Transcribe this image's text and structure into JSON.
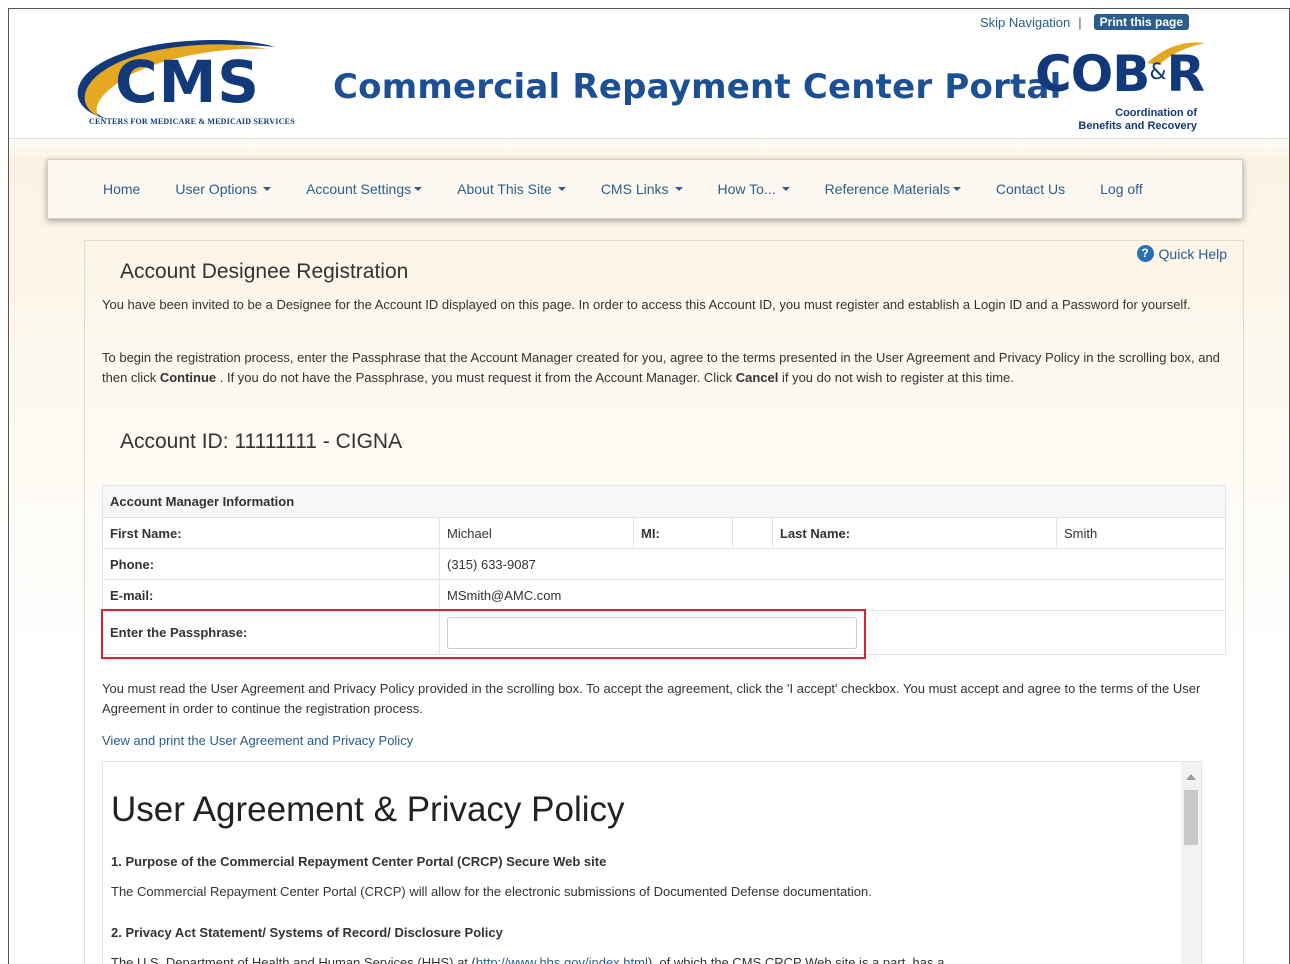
{
  "header": {
    "skip_nav": "Skip Navigation",
    "separator": "|",
    "print_label": "Print this page",
    "cms_logo_text": "CMS",
    "cms_logo_subtitle": "CENTERS FOR MEDICARE & MEDICAID SERVICES",
    "portal_title": "Commercial Repayment Center Portal",
    "cob_logo_main": "COB",
    "cob_logo_amp": "&",
    "cob_logo_r": "R",
    "cob_logo_line1": "Coordination of",
    "cob_logo_line2": "Benefits and Recovery"
  },
  "nav": {
    "items": [
      {
        "label": "Home",
        "dropdown": false
      },
      {
        "label": "User Options",
        "dropdown": true
      },
      {
        "label": "Account Settings",
        "dropdown": true
      },
      {
        "label": "About This Site",
        "dropdown": true
      },
      {
        "label": "CMS Links",
        "dropdown": true
      },
      {
        "label": "How To...",
        "dropdown": true
      },
      {
        "label": "Reference Materials",
        "dropdown": true
      },
      {
        "label": "Contact Us",
        "dropdown": false
      },
      {
        "label": "Log off",
        "dropdown": false
      }
    ]
  },
  "main": {
    "quick_help": "Quick Help",
    "help_icon_glyph": "?",
    "title": "Account Designee Registration",
    "intro1": "You have been invited to be a Designee for the Account ID displayed on this page. In order to access this Account ID, you must register and establish a Login ID and a Password for yourself.",
    "intro2_a": "To begin the registration process, enter the Passphrase that the Account Manager created for you, agree to the terms presented in the User Agreement and Privacy Policy in the scrolling box, and then click ",
    "intro2_continue": "Continue",
    "intro2_b": " . If you do not have the Passphrase, you must request it from the Account Manager. Click ",
    "intro2_cancel": "Cancel",
    "intro2_c": " if you do not wish to register at this time.",
    "account_id": "Account ID: 11111111 - CIGNA"
  },
  "manager_table": {
    "header": "Account Manager Information",
    "first_name_label": "First Name:",
    "first_name": "Michael",
    "mi_label": "MI:",
    "mi": "",
    "last_name_label": "Last Name:",
    "last_name": "Smith",
    "phone_label": "Phone:",
    "phone": "(315) 633-9087",
    "email_label": "E-mail:",
    "email": "MSmith@AMC.com",
    "passphrase_label": "Enter the Passphrase:",
    "passphrase_value": ""
  },
  "agreement": {
    "instructions": "You must read the User Agreement and Privacy Policy provided in the scrolling box. To accept the agreement, click the 'I accept' checkbox. You must accept and agree to the terms of the User Agreement in order to continue the registration process.",
    "view_print_link": "View and print the User Agreement and Privacy Policy",
    "title": "User Agreement & Privacy Policy",
    "s1_heading": "1. Purpose of the Commercial Repayment Center Portal (CRCP) Secure Web site",
    "s1_text": "The Commercial Repayment Center Portal (CRCP) will allow for the electronic submissions of Documented Defense documentation.",
    "s2_heading": "2. Privacy Act Statement/ Systems of Record/ Disclosure Policy",
    "s2_text_a": "The U.S. Department of Health and Human Services (HHS) at (",
    "s2_link": "http://www.hhs.gov/index.html",
    "s2_text_b": "), of which the CMS CRCP Web site is a part, has a"
  },
  "colors": {
    "brand_blue": "#1c4f94",
    "link_blue": "#2a5d8c",
    "highlight_red": "#d9232e",
    "swoosh_gold": "#e5a823"
  }
}
